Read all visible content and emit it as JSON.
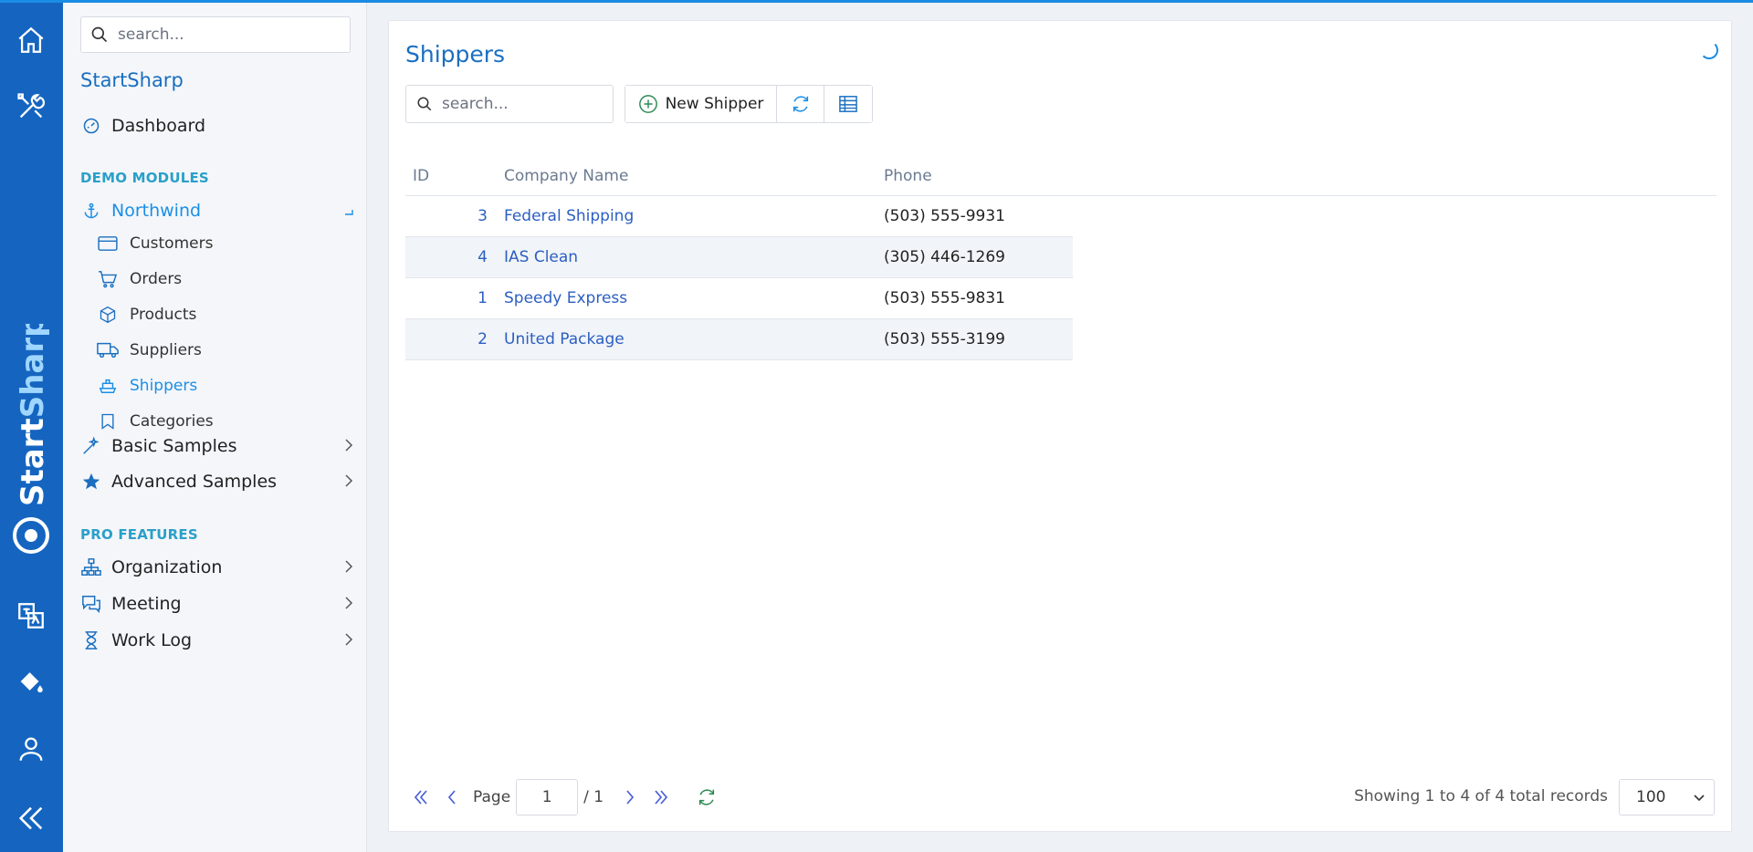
{
  "rail": {
    "brand": {
      "start": "Start",
      "sharp": "Sharp"
    }
  },
  "sidebar": {
    "search_placeholder": "search...",
    "app_title": "StartSharp",
    "dashboard": "Dashboard",
    "demo_modules": "DEMO MODULES",
    "northwind": "Northwind",
    "northwind_items": [
      {
        "label": "Customers",
        "icon": "credit-card-icon"
      },
      {
        "label": "Orders",
        "icon": "cart-icon"
      },
      {
        "label": "Products",
        "icon": "box-icon"
      },
      {
        "label": "Suppliers",
        "icon": "truck-icon"
      },
      {
        "label": "Shippers",
        "icon": "ship-icon"
      },
      {
        "label": "Categories",
        "icon": "bookmark-icon"
      }
    ],
    "basic_samples": "Basic Samples",
    "advanced_samples": "Advanced Samples",
    "pro_features": "PRO FEATURES",
    "organization": "Organization",
    "meeting": "Meeting",
    "work_log": "Work Log"
  },
  "main": {
    "title": "Shippers",
    "search_placeholder": "search...",
    "new_button": "New Shipper",
    "columns": {
      "id": "ID",
      "company": "Company Name",
      "phone": "Phone"
    },
    "rows": [
      {
        "id": "3",
        "company": "Federal Shipping",
        "phone": "(503) 555-9931"
      },
      {
        "id": "4",
        "company": "IAS Clean",
        "phone": "(305) 446-1269"
      },
      {
        "id": "1",
        "company": "Speedy Express",
        "phone": "(503) 555-9831"
      },
      {
        "id": "2",
        "company": "United Package",
        "phone": "(503) 555-3199"
      }
    ],
    "pager": {
      "page_label": "Page",
      "page_value": "1",
      "total_pages": "/ 1",
      "status": "Showing 1 to 4 of 4 total records",
      "page_size": "100"
    }
  },
  "colors": {
    "rail": "#1565c0",
    "accent": "#1a8fe6",
    "title": "#1a6fc0",
    "section": "#2aa0c9"
  }
}
